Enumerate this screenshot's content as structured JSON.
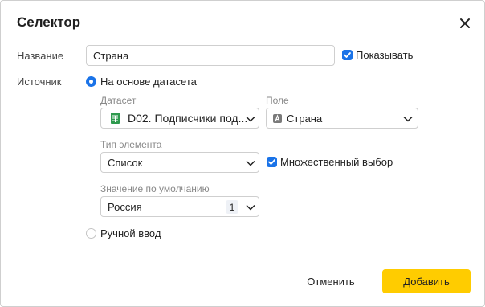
{
  "dialog": {
    "title": "Селектор",
    "name_label": "Название",
    "name_value": "Страна",
    "show_label": "Показывать",
    "source_label": "Источник",
    "radio_dataset_label": "На основе датасета",
    "dataset_label": "Датасет",
    "dataset_value": "D02. Подписчики под...",
    "field_label": "Поле",
    "field_value": "Страна",
    "element_type_label": "Тип элемента",
    "element_type_value": "Список",
    "multiple_label": "Множественный выбор",
    "default_label": "Значение по умолчанию",
    "default_value": "Россия",
    "default_count": "1",
    "radio_manual_label": "Ручной ввод",
    "cancel_label": "Отменить",
    "add_label": "Добавить"
  },
  "colors": {
    "accent": "#1a73e8",
    "primary_button": "#ffcc00",
    "sheet_icon": "#2e9a4e"
  }
}
